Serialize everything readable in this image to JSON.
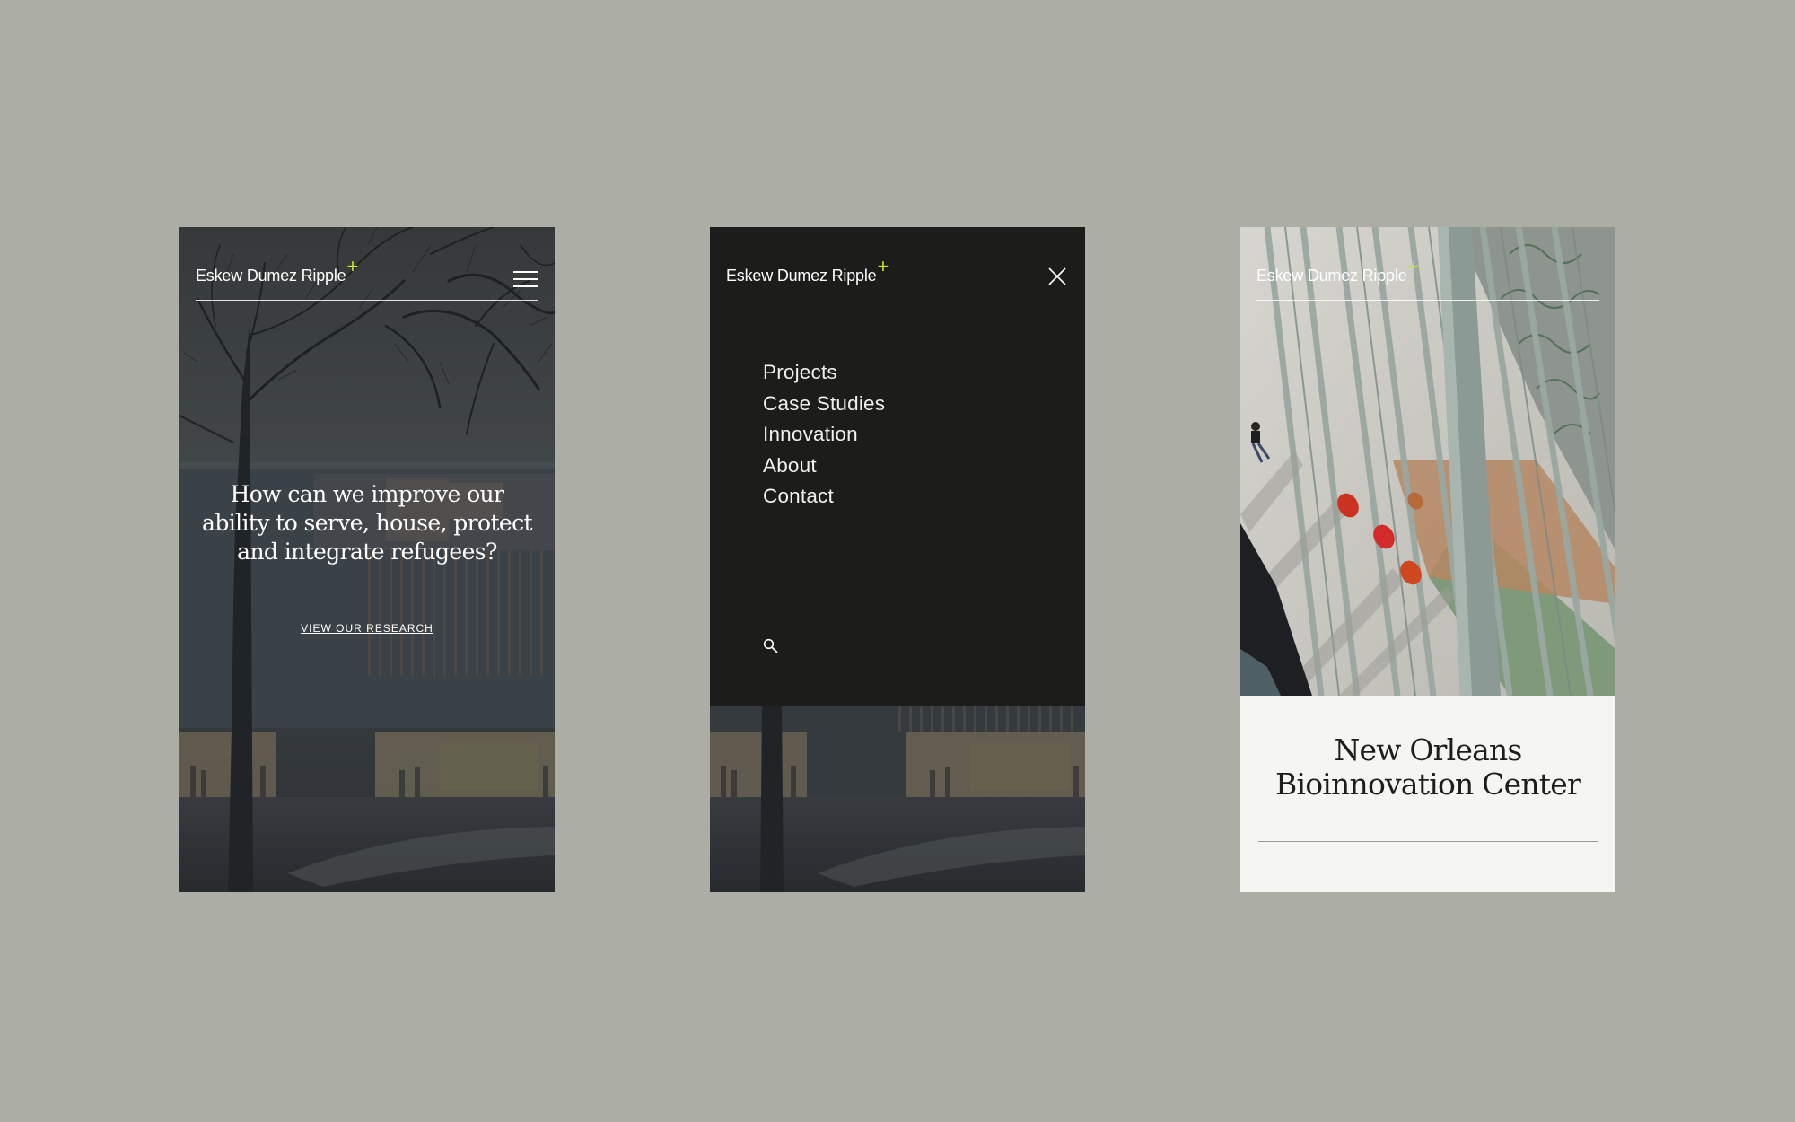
{
  "colors": {
    "page_background": "#acaea6",
    "logo_plus_accent": "#c6e62a",
    "menu_background": "#1c1c1a",
    "project_card_background": "#f5f5f3"
  },
  "screens": [
    {
      "id": "home",
      "logo_text": "Eskew Dumez Ripple",
      "logo_mark": "+",
      "menu_icon": "hamburger-icon",
      "hero_title": "How can we improve our ability to serve, house, protect and integrate refugees?",
      "hero_link": "VIEW OUR RESEARCH"
    },
    {
      "id": "menu",
      "logo_text": "Eskew Dumez Ripple",
      "logo_mark": "+",
      "close_icon": "close-icon",
      "nav_items": [
        "Projects",
        "Case Studies",
        "Innovation",
        "About",
        "Contact"
      ],
      "search_icon": "search-icon"
    },
    {
      "id": "project",
      "logo_text": "Eskew Dumez Ripple",
      "logo_mark": "+",
      "project_title": "New Orleans Bioinnovation Center"
    }
  ]
}
